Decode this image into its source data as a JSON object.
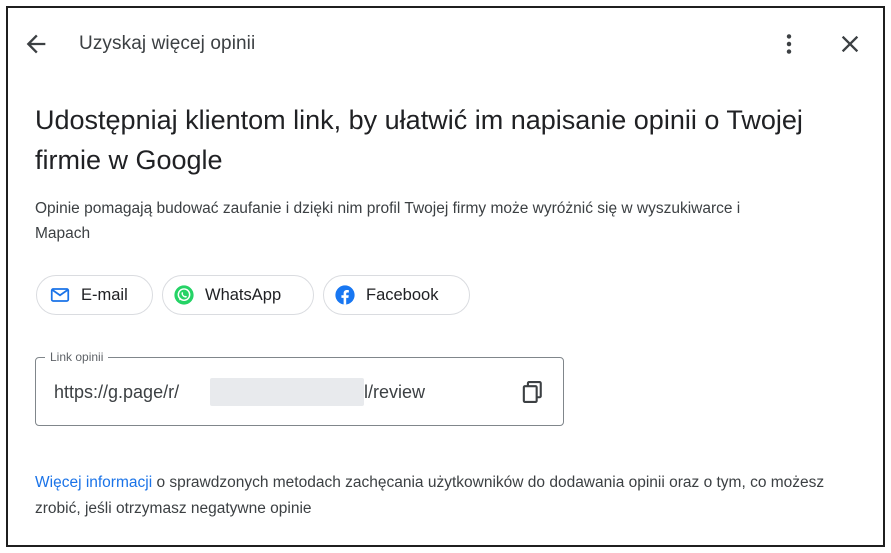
{
  "header": {
    "title": "Uzyskaj więcej opinii"
  },
  "main": {
    "headline": "Udostępniaj klientom link, by ułatwić im napisanie opinii o Twojej firmie w Google",
    "description": "Opinie pomagają budować zaufanie i dzięki nim profil Twojej firmy może wyróżnić się w wyszukiwarce i Mapach",
    "share_buttons": [
      {
        "label": "E-mail",
        "icon": "mail-icon"
      },
      {
        "label": "WhatsApp",
        "icon": "whatsapp-icon"
      },
      {
        "label": "Facebook",
        "icon": "facebook-icon"
      }
    ],
    "link_field": {
      "label": "Link opinii",
      "value_prefix": "https://g.page/r/",
      "value_suffix": "l/review"
    },
    "info": {
      "link_text": "Więcej informacji",
      "rest_text": " o sprawdzonych metodach zachęcania użytkowników do dodawania opinii oraz o tym, co możesz zrobić, jeśli otrzymasz negatywne opinie"
    }
  },
  "colors": {
    "text": "#202124",
    "secondary_text": "#3c4043",
    "link": "#1a73e8",
    "chip_border": "#dadce0",
    "whatsapp": "#25d366",
    "facebook": "#1877f2",
    "mail": "#1a73e8"
  }
}
